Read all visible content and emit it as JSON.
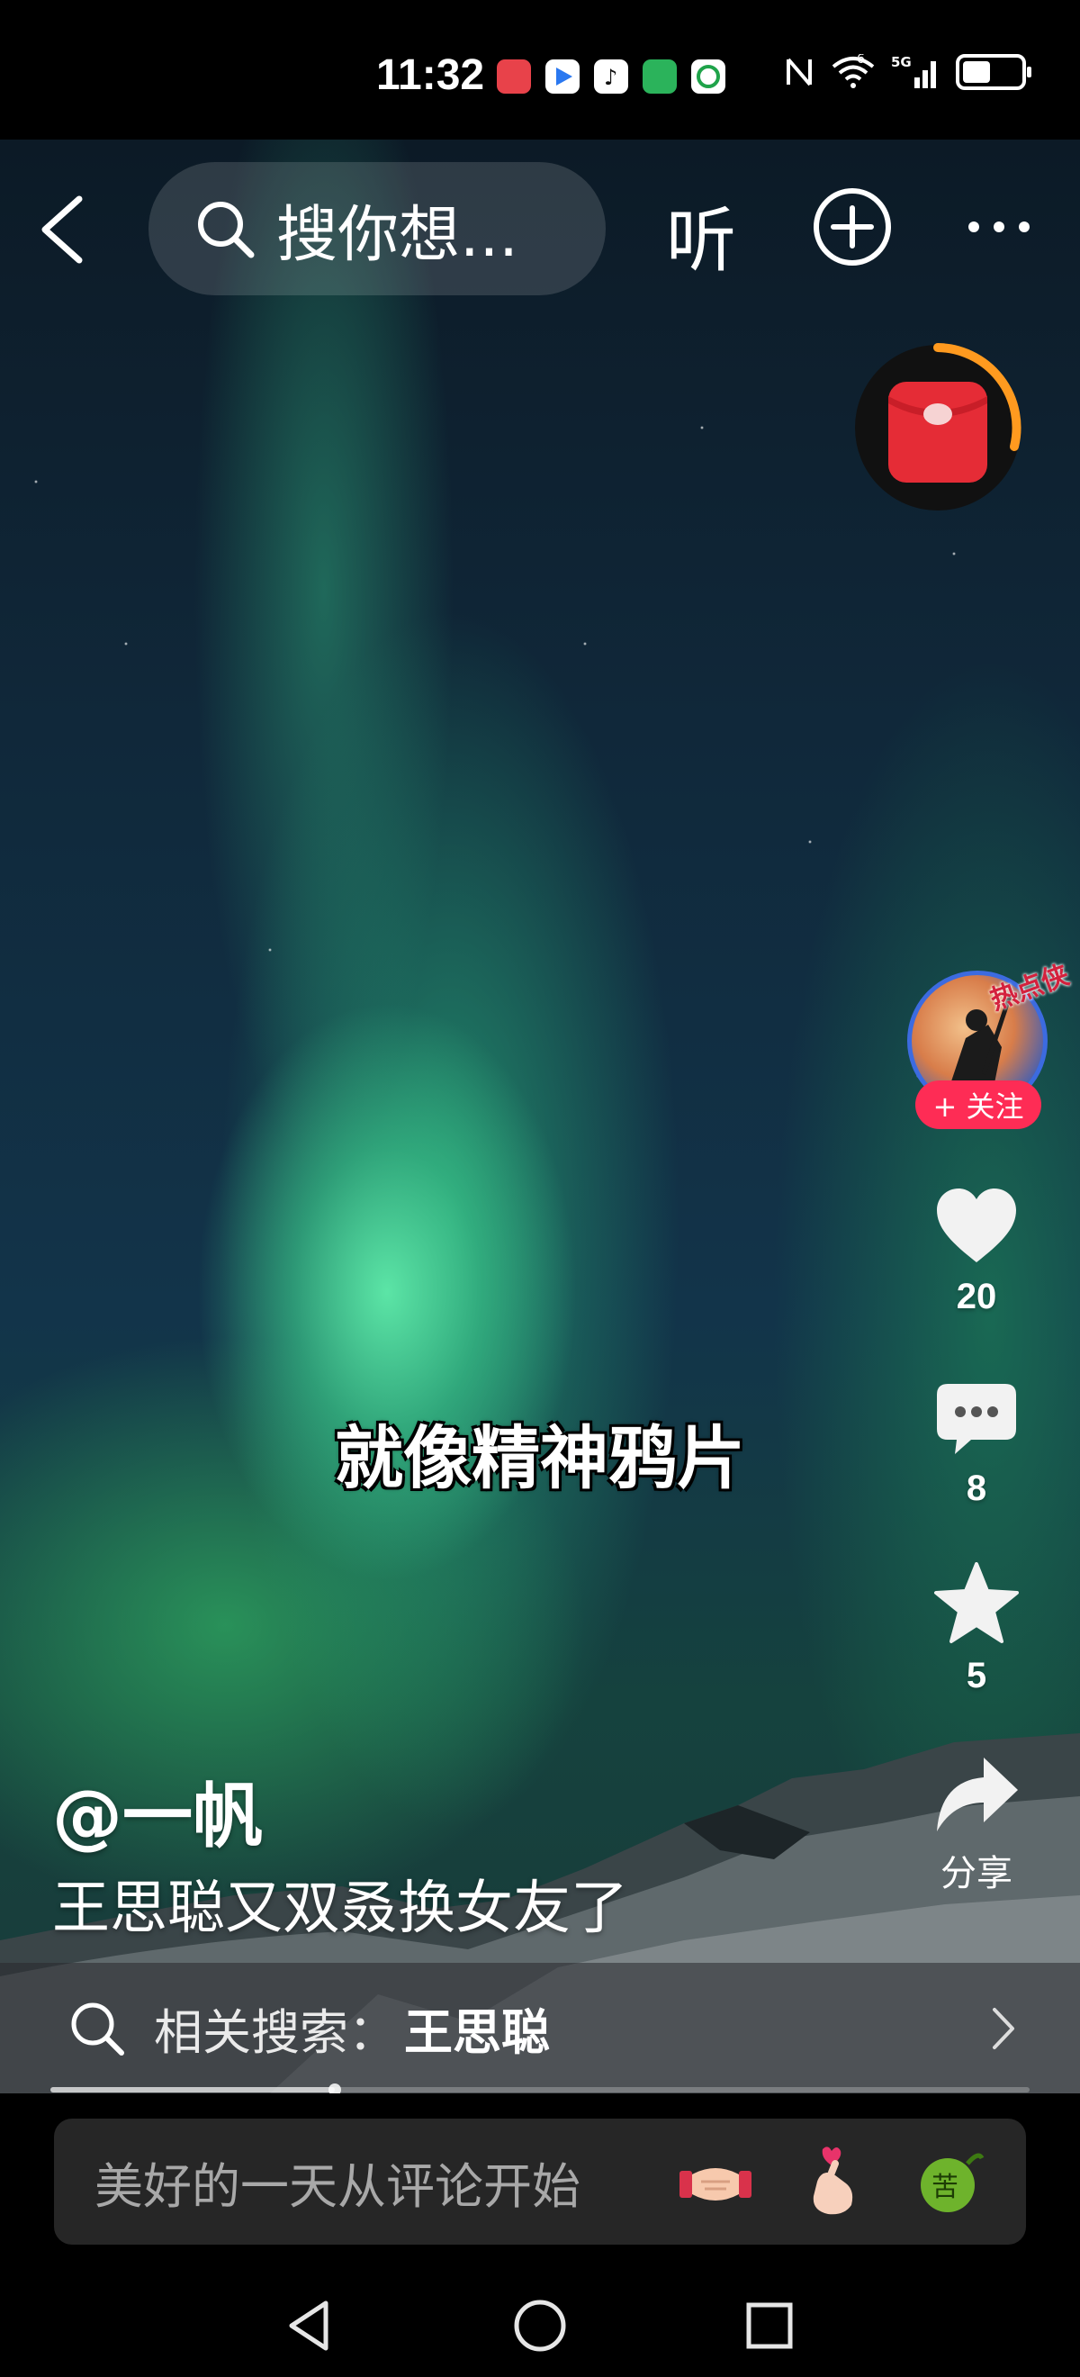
{
  "status_bar": {
    "time": "11:32",
    "network": "5G",
    "wifi": "6",
    "app_icons": [
      "huawei-appgallery-icon",
      "video-player-icon",
      "douyin-lite-icon",
      "green-app-icon",
      "china-mobile-icon"
    ]
  },
  "top_nav": {
    "search_placeholder": "搜你想...",
    "listen_label": "听"
  },
  "video": {
    "subtitle": "就像精神鸦片",
    "author": "@一帆",
    "caption": "王思聪又双叒换女友了"
  },
  "rail": {
    "avatar_badge": "热点侠",
    "follow_label": "+ 关注",
    "like_count": "20",
    "comment_count": "8",
    "favorite_count": "5",
    "share_label": "分享"
  },
  "related_search": {
    "prefix": "相关搜索：",
    "term": "王思聪"
  },
  "progress": {
    "fraction": 0.29
  },
  "comment_bar": {
    "placeholder": "美好的一天从评论开始",
    "emojis": [
      "handshake-emoji",
      "finger-heart-emoji",
      "bitter-melon-emoji"
    ]
  },
  "colors": {
    "accent": "#fe2c55",
    "red_packet": "#e52c36",
    "timer_ring": "#ff9a1f"
  }
}
